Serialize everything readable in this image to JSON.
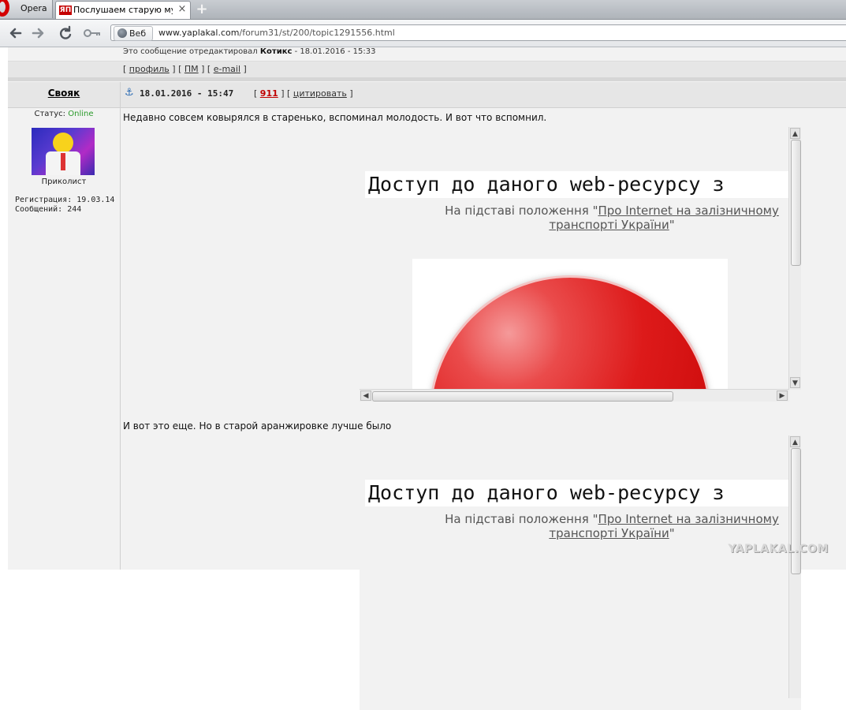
{
  "browser": {
    "menu_label": "Opera",
    "tab": {
      "favicon_text": "ЯП",
      "title": "Послушаем старую муз..."
    },
    "new_tab_glyph": "+",
    "address": {
      "badge": "Веб",
      "url_domain": "www.yaplakal.com",
      "url_path": "/forum31/st/200/topic1291556.html"
    }
  },
  "prev_post": {
    "edit_note_prefix": "Это сообщение отредактировал",
    "edit_note_author": "Котикс",
    "edit_note_date": "- 18.01.2016 - 15:33",
    "links": {
      "profile": "профиль",
      "pm": "ПМ",
      "email": "e-mail"
    }
  },
  "post": {
    "author": "Свояк",
    "date": "18.01.2016 - 15:47",
    "rating": "911",
    "quote_label": "цитировать",
    "status_label": "Статус:",
    "status_value": "Online",
    "rank": "Приколист",
    "registration": "Регистрация: 19.03.14",
    "messages": "Сообщений: 244",
    "text1": "Недавно совсем ковырялся в старенько, вспоминал молодость. И вот что вспомнил.",
    "text2": "И вот это еще. Но в старой аранжировке лучше было",
    "blocked": {
      "title": "Доступ до даного web-ресурсу з",
      "sub_prefix": "На підставі положення \"",
      "sub_link_line1": "Про Internet на залізничному",
      "sub_link_line2": "транспорті України",
      "sub_suffix": "\""
    }
  },
  "watermark": "YAPLAKAL.COM",
  "icons": [
    "opera-icon",
    "back-icon",
    "forward-icon",
    "reload-icon",
    "key-icon",
    "globe-icon",
    "anchor-icon",
    "close-icon"
  ]
}
